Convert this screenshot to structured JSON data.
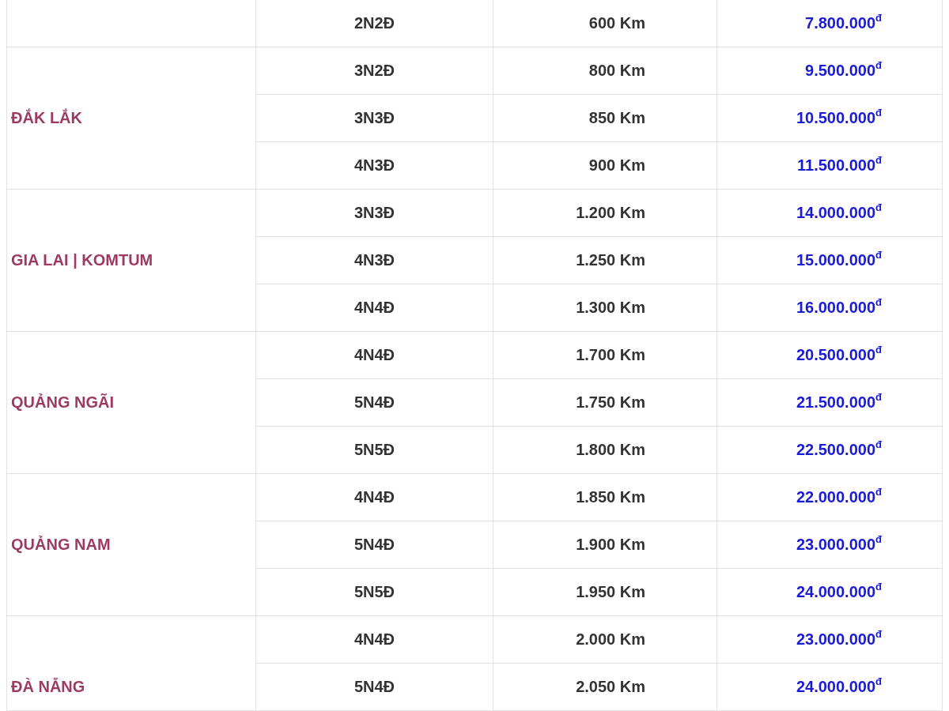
{
  "groups": [
    {
      "rows": [
        {
          "duration": "2N2Đ",
          "distance": "600 Km",
          "price": "7.800.000$^{đ}$"
        }
      ]
    },
    {
      "region": "ĐẮK LẮK",
      "rows": [
        {
          "duration": "3N2Đ",
          "distance": "800 Km",
          "price": "9.500.000$^{đ}$"
        },
        {
          "duration": "3N3Đ",
          "distance": "850 Km",
          "price": "10.500.000$^{đ}$"
        },
        {
          "duration": "4N3Đ",
          "distance": "900 Km",
          "price": "11.500.000$^{đ}$"
        }
      ]
    },
    {
      "region": "GIA LAI | KOMTUM",
      "rows": [
        {
          "duration": "3N3Đ",
          "distance": "1.200 Km",
          "price": "14.000.000$^{đ}$"
        },
        {
          "duration": "4N3Đ",
          "distance": "1.250 Km",
          "price": "15.000.000$^{đ}$"
        },
        {
          "duration": "4N4Đ",
          "distance": "1.300 Km",
          "price": "16.000.000$^{đ}$"
        }
      ]
    },
    {
      "region": "QUẢNG NGÃI",
      "rows": [
        {
          "duration": "4N4Đ",
          "distance": "1.700 Km",
          "price": "20.500.000$^{đ}$"
        },
        {
          "duration": "5N4Đ",
          "distance": "1.750 Km",
          "price": "21.500.000$^{đ}$"
        },
        {
          "duration": "5N5Đ",
          "distance": "1.800 Km",
          "price": "22.500.000$^{đ}$"
        }
      ]
    },
    {
      "region": "QUẢNG NAM",
      "rows": [
        {
          "duration": "4N4Đ",
          "distance": "1.850 Km",
          "price": "22.000.000$^{đ}$"
        },
        {
          "duration": "5N4Đ",
          "distance": "1.900 Km",
          "price": "23.000.000$^{đ}$"
        },
        {
          "duration": "5N5Đ",
          "distance": "1.950 Km",
          "price": "24.000.000$^{đ}$"
        }
      ]
    },
    {
      "region": "ĐÀ NẴNG",
      "cut": true,
      "rows": [
        {
          "duration": "4N4Đ",
          "distance": "2.000 Km",
          "price": "23.000.000$^{đ}$"
        },
        {
          "duration": "5N4Đ",
          "distance": "2.050 Km",
          "price": "24.000.000$^{đ}$"
        }
      ]
    }
  ]
}
